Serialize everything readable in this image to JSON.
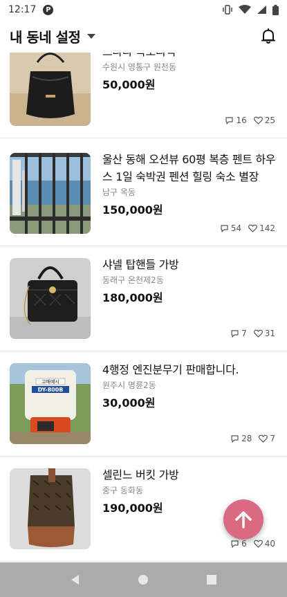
{
  "status_bar": {
    "time": "12:17",
    "app_badge": "P"
  },
  "header": {
    "title": "내 동네 설정"
  },
  "items": [
    {
      "title": "프라다 복조리백",
      "location": "수원시 영통구 원천동",
      "price": "50,000원",
      "chats": "16",
      "likes": "25"
    },
    {
      "title": "울산 동해 오션뷰 60평 복층 펜트 하우스 1일 숙박권 펜션 힐링 숙소 별장",
      "location": "남구 옥동",
      "price": "150,000원",
      "chats": "54",
      "likes": "142"
    },
    {
      "title": "샤넬 탑핸들 가방",
      "location": "동래구 온천제2동",
      "price": "180,000원",
      "chats": "7",
      "likes": "31"
    },
    {
      "title": "4행정 엔진분무기 판매합니다.",
      "location": "원주시 명륜2동",
      "price": "30,000원",
      "chats": "28",
      "likes": "7"
    },
    {
      "title": "셀린느 버킷 가방",
      "location": "중구 동화동",
      "price": "190,000원",
      "chats": "6",
      "likes": "40"
    }
  ],
  "sprayer_label": {
    "line1": "고매예시",
    "line2": "DY-800B"
  },
  "colors": {
    "fab": "#d96a7f",
    "nav_bar": "#ababab",
    "divider": "#e6e6e6"
  }
}
